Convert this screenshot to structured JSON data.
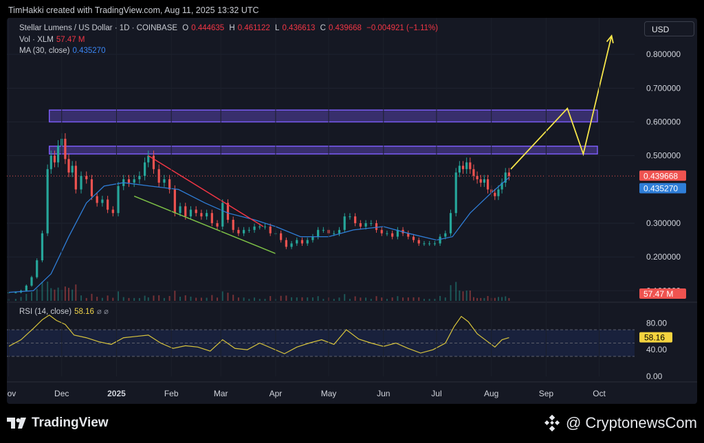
{
  "header": {
    "attribution": "TimHakki created with TradingView.com, Aug 11, 2025 13:32 UTC"
  },
  "legend": {
    "symbol": "Stellar Lumens / US Dollar · 1D · COINBASE",
    "o_label": "O",
    "o_value": "0.444635",
    "h_label": "H",
    "h_value": "0.461122",
    "l_label": "L",
    "l_value": "0.436613",
    "c_label": "C",
    "c_value": "0.439668",
    "change": "−0.004921 (−1.11%)",
    "vol_label": "Vol · XLM",
    "vol_value": "57.47 M",
    "ma_label": "MA (30, close)",
    "ma_value": "0.435270",
    "rsi_label": "RSI (14, close)",
    "rsi_value": "58.16",
    "rsi_icons": "⌀ ⌀"
  },
  "currency_button": "USD",
  "footer": {
    "logo_text": "TradingView",
    "credit": "@ CryptonewsCom"
  },
  "colors": {
    "up": "#26a69a",
    "down": "#ef5350",
    "ma": "#2f7ed8",
    "zone": "#7b5cf5",
    "resistance_line": "#f23645",
    "support_line": "#7dc146",
    "projection": "#f7e64a",
    "rsi": "#d9c53c"
  },
  "chart_data": [
    {
      "type": "candlestick",
      "title": "Stellar Lumens / US Dollar · 1D · COINBASE",
      "x_ticks": [
        "Nov",
        "Dec",
        "2025",
        "Feb",
        "Mar",
        "Apr",
        "May",
        "Jun",
        "Jul",
        "Aug",
        "Sep",
        "Oct"
      ],
      "y_ticks": [
        "0.800000",
        "0.700000",
        "0.600000",
        "0.500000",
        "0.300000",
        "0.200000",
        "0.100000"
      ],
      "ylim": [
        0.07,
        0.9
      ],
      "price_close_series": [
        [
          "2024-11-01",
          0.095
        ],
        [
          "2024-11-05",
          0.095
        ],
        [
          "2024-11-08",
          0.1
        ],
        [
          "2024-11-11",
          0.115
        ],
        [
          "2024-11-14",
          0.14
        ],
        [
          "2024-11-17",
          0.19
        ],
        [
          "2024-11-20",
          0.27
        ],
        [
          "2024-11-23",
          0.46
        ],
        [
          "2024-11-25",
          0.5
        ],
        [
          "2024-11-27",
          0.48
        ],
        [
          "2024-11-29",
          0.53
        ],
        [
          "2024-12-01",
          0.55
        ],
        [
          "2024-12-03",
          0.49
        ],
        [
          "2024-12-05",
          0.45
        ],
        [
          "2024-12-07",
          0.47
        ],
        [
          "2024-12-09",
          0.4
        ],
        [
          "2024-12-12",
          0.44
        ],
        [
          "2024-12-15",
          0.43
        ],
        [
          "2024-12-18",
          0.38
        ],
        [
          "2024-12-21",
          0.36
        ],
        [
          "2024-12-24",
          0.37
        ],
        [
          "2024-12-27",
          0.34
        ],
        [
          "2024-12-30",
          0.33
        ],
        [
          "2025-01-02",
          0.41
        ],
        [
          "2025-01-05",
          0.43
        ],
        [
          "2025-01-08",
          0.42
        ],
        [
          "2025-01-11",
          0.43
        ],
        [
          "2025-01-14",
          0.44
        ],
        [
          "2025-01-17",
          0.48
        ],
        [
          "2025-01-19",
          0.5
        ],
        [
          "2025-01-22",
          0.46
        ],
        [
          "2025-01-25",
          0.42
        ],
        [
          "2025-01-28",
          0.43
        ],
        [
          "2025-01-31",
          0.4
        ],
        [
          "2025-02-03",
          0.33
        ],
        [
          "2025-02-06",
          0.35
        ],
        [
          "2025-02-09",
          0.32
        ],
        [
          "2025-02-12",
          0.34
        ],
        [
          "2025-02-15",
          0.33
        ],
        [
          "2025-02-18",
          0.32
        ],
        [
          "2025-02-21",
          0.33
        ],
        [
          "2025-02-24",
          0.3
        ],
        [
          "2025-02-27",
          0.29
        ],
        [
          "2025-03-02",
          0.36
        ],
        [
          "2025-03-05",
          0.31
        ],
        [
          "2025-03-08",
          0.28
        ],
        [
          "2025-03-11",
          0.27
        ],
        [
          "2025-03-14",
          0.28
        ],
        [
          "2025-03-17",
          0.28
        ],
        [
          "2025-03-20",
          0.29
        ],
        [
          "2025-03-23",
          0.29
        ],
        [
          "2025-03-26",
          0.29
        ],
        [
          "2025-03-29",
          0.27
        ],
        [
          "2025-04-01",
          0.27
        ],
        [
          "2025-04-04",
          0.25
        ],
        [
          "2025-04-07",
          0.23
        ],
        [
          "2025-04-10",
          0.24
        ],
        [
          "2025-04-13",
          0.25
        ],
        [
          "2025-04-16",
          0.24
        ],
        [
          "2025-04-19",
          0.25
        ],
        [
          "2025-04-22",
          0.26
        ],
        [
          "2025-04-25",
          0.28
        ],
        [
          "2025-04-28",
          0.28
        ],
        [
          "2025-05-01",
          0.27
        ],
        [
          "2025-05-04",
          0.27
        ],
        [
          "2025-05-07",
          0.28
        ],
        [
          "2025-05-10",
          0.32
        ],
        [
          "2025-05-13",
          0.32
        ],
        [
          "2025-05-16",
          0.3
        ],
        [
          "2025-05-19",
          0.29
        ],
        [
          "2025-05-22",
          0.3
        ],
        [
          "2025-05-25",
          0.3
        ],
        [
          "2025-05-28",
          0.28
        ],
        [
          "2025-05-31",
          0.27
        ],
        [
          "2025-06-03",
          0.27
        ],
        [
          "2025-06-06",
          0.26
        ],
        [
          "2025-06-09",
          0.28
        ],
        [
          "2025-06-12",
          0.27
        ],
        [
          "2025-06-15",
          0.26
        ],
        [
          "2025-06-18",
          0.25
        ],
        [
          "2025-06-21",
          0.24
        ],
        [
          "2025-06-24",
          0.24
        ],
        [
          "2025-06-27",
          0.24
        ],
        [
          "2025-06-30",
          0.24
        ],
        [
          "2025-07-03",
          0.26
        ],
        [
          "2025-07-06",
          0.27
        ],
        [
          "2025-07-09",
          0.33
        ],
        [
          "2025-07-12",
          0.45
        ],
        [
          "2025-07-14",
          0.47
        ],
        [
          "2025-07-16",
          0.46
        ],
        [
          "2025-07-18",
          0.48
        ],
        [
          "2025-07-20",
          0.46
        ],
        [
          "2025-07-22",
          0.44
        ],
        [
          "2025-07-24",
          0.43
        ],
        [
          "2025-07-26",
          0.42
        ],
        [
          "2025-07-28",
          0.43
        ],
        [
          "2025-07-30",
          0.4
        ],
        [
          "2025-08-01",
          0.39
        ],
        [
          "2025-08-03",
          0.38
        ],
        [
          "2025-08-05",
          0.4
        ],
        [
          "2025-08-07",
          0.42
        ],
        [
          "2025-08-09",
          0.45
        ],
        [
          "2025-08-11",
          0.44
        ]
      ],
      "ma_30": [
        [
          "2024-11-01",
          0.095
        ],
        [
          "2024-11-15",
          0.1
        ],
        [
          "2024-11-25",
          0.15
        ],
        [
          "2024-12-05",
          0.26
        ],
        [
          "2024-12-15",
          0.36
        ],
        [
          "2024-12-25",
          0.41
        ],
        [
          "2025-01-05",
          0.42
        ],
        [
          "2025-01-20",
          0.41
        ],
        [
          "2025-02-05",
          0.4
        ],
        [
          "2025-02-20",
          0.36
        ],
        [
          "2025-03-05",
          0.33
        ],
        [
          "2025-03-20",
          0.31
        ],
        [
          "2025-04-01",
          0.29
        ],
        [
          "2025-04-15",
          0.26
        ],
        [
          "2025-05-01",
          0.26
        ],
        [
          "2025-05-15",
          0.28
        ],
        [
          "2025-06-01",
          0.29
        ],
        [
          "2025-06-15",
          0.27
        ],
        [
          "2025-07-01",
          0.25
        ],
        [
          "2025-07-10",
          0.26
        ],
        [
          "2025-07-20",
          0.33
        ],
        [
          "2025-08-01",
          0.39
        ],
        [
          "2025-08-11",
          0.43527
        ]
      ],
      "horizontal_zones": [
        {
          "from": "2024-11-24",
          "to": "2025-09-30",
          "low": 0.6,
          "high": 0.635
        },
        {
          "from": "2024-11-24",
          "to": "2025-09-30",
          "low": 0.505,
          "high": 0.528
        }
      ],
      "trendlines": [
        {
          "role": "resistance",
          "from": [
            "2025-01-19",
            0.5
          ],
          "to": [
            "2025-03-25",
            0.29
          ]
        },
        {
          "role": "support",
          "from": [
            "2025-01-11",
            0.38
          ],
          "to": [
            "2025-04-01",
            0.21
          ]
        }
      ],
      "projection_path": [
        [
          "2025-08-12",
          0.46
        ],
        [
          "2025-09-13",
          0.64
        ],
        [
          "2025-09-22",
          0.505
        ],
        [
          "2025-10-08",
          0.855
        ]
      ],
      "last_price": "0.439668",
      "ma_last": "0.435270",
      "volume_last": "57.47 M"
    },
    {
      "type": "line",
      "title": "RSI (14, close)",
      "y_ticks": [
        "80.00",
        "40.00",
        "0.00"
      ],
      "ylim": [
        0,
        100
      ],
      "bands": [
        70,
        50,
        30
      ],
      "last": "58.16",
      "series": [
        [
          "2024-11-01",
          45
        ],
        [
          "2024-11-08",
          55
        ],
        [
          "2024-11-15",
          72
        ],
        [
          "2024-11-20",
          85
        ],
        [
          "2024-11-24",
          92
        ],
        [
          "2024-11-28",
          84
        ],
        [
          "2024-12-03",
          78
        ],
        [
          "2024-12-08",
          62
        ],
        [
          "2024-12-15",
          58
        ],
        [
          "2024-12-22",
          52
        ],
        [
          "2024-12-29",
          48
        ],
        [
          "2025-01-05",
          58
        ],
        [
          "2025-01-12",
          60
        ],
        [
          "2025-01-19",
          62
        ],
        [
          "2025-01-26",
          50
        ],
        [
          "2025-02-02",
          42
        ],
        [
          "2025-02-09",
          46
        ],
        [
          "2025-02-16",
          44
        ],
        [
          "2025-02-23",
          38
        ],
        [
          "2025-03-02",
          55
        ],
        [
          "2025-03-09",
          42
        ],
        [
          "2025-03-16",
          40
        ],
        [
          "2025-03-23",
          50
        ],
        [
          "2025-03-30",
          42
        ],
        [
          "2025-04-06",
          34
        ],
        [
          "2025-04-13",
          44
        ],
        [
          "2025-04-20",
          50
        ],
        [
          "2025-04-27",
          55
        ],
        [
          "2025-05-04",
          48
        ],
        [
          "2025-05-11",
          70
        ],
        [
          "2025-05-18",
          56
        ],
        [
          "2025-05-25",
          50
        ],
        [
          "2025-06-01",
          45
        ],
        [
          "2025-06-08",
          50
        ],
        [
          "2025-06-15",
          42
        ],
        [
          "2025-06-22",
          35
        ],
        [
          "2025-06-29",
          40
        ],
        [
          "2025-07-06",
          50
        ],
        [
          "2025-07-11",
          75
        ],
        [
          "2025-07-15",
          90
        ],
        [
          "2025-07-19",
          82
        ],
        [
          "2025-07-24",
          64
        ],
        [
          "2025-07-30",
          52
        ],
        [
          "2025-08-03",
          44
        ],
        [
          "2025-08-07",
          55
        ],
        [
          "2025-08-11",
          58.16
        ]
      ]
    }
  ]
}
